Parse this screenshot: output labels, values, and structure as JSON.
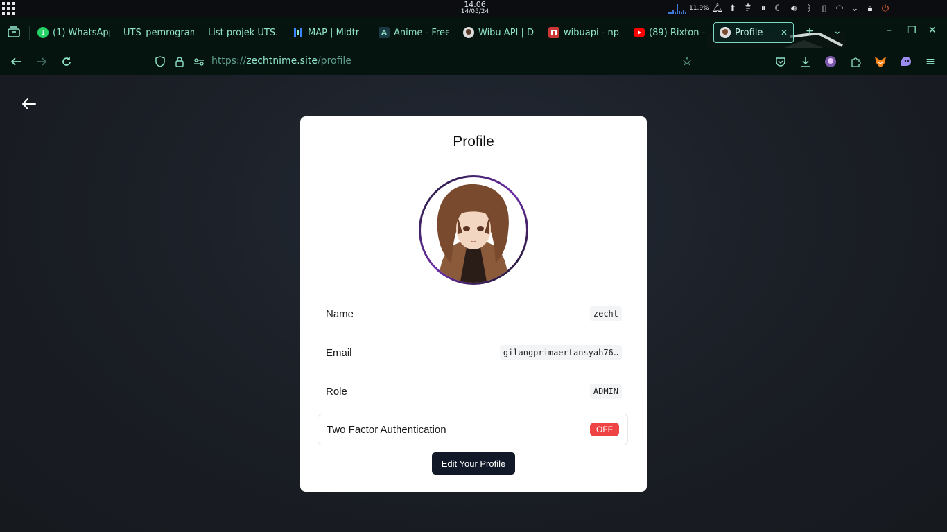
{
  "system_bar": {
    "time": "14.06",
    "date": "14/05/24",
    "cpu_usage": "11,9%",
    "tray_icons": [
      "cpu-graph-icon",
      "notification-bell-icon",
      "update-icon",
      "clipboard-icon",
      "media-icon",
      "night-light-icon",
      "volume-icon",
      "bluetooth-icon",
      "battery-icon",
      "wifi-icon",
      "chevron-down-icon",
      "lock-icon",
      "power-icon"
    ]
  },
  "browser": {
    "tabs": [
      {
        "label": "(1) WhatsApp",
        "icon": "whatsapp-icon"
      },
      {
        "label": "UTS_pemrogram",
        "icon": ""
      },
      {
        "label": "List projek UTS.p",
        "icon": ""
      },
      {
        "label": "MAP | Midtr",
        "icon": "midtrans-icon"
      },
      {
        "label": "Anime - Free",
        "icon": "anime-icon"
      },
      {
        "label": "Wibu API | D",
        "icon": "wibu-api-icon"
      },
      {
        "label": "wibuapi - np",
        "icon": "npm-icon"
      },
      {
        "label": "(89) Rixton -",
        "icon": "youtube-icon"
      },
      {
        "label": "Profile",
        "icon": "avatar-favicon-icon"
      }
    ],
    "url": {
      "scheme": "https://",
      "host": "zechtnime.site",
      "path": "/profile"
    },
    "accent_color": "#8fe3c9"
  },
  "page": {
    "title": "Profile",
    "fields": [
      {
        "label": "Name",
        "value": "zecht"
      },
      {
        "label": "Email",
        "value": "gilangprimaertansyah76…"
      },
      {
        "label": "Role",
        "value": "ADMIN"
      }
    ],
    "two_factor": {
      "label": "Two Factor Authentication",
      "status": "OFF",
      "status_color": "#ef4444"
    },
    "edit_button": "Edit Your Profile"
  }
}
